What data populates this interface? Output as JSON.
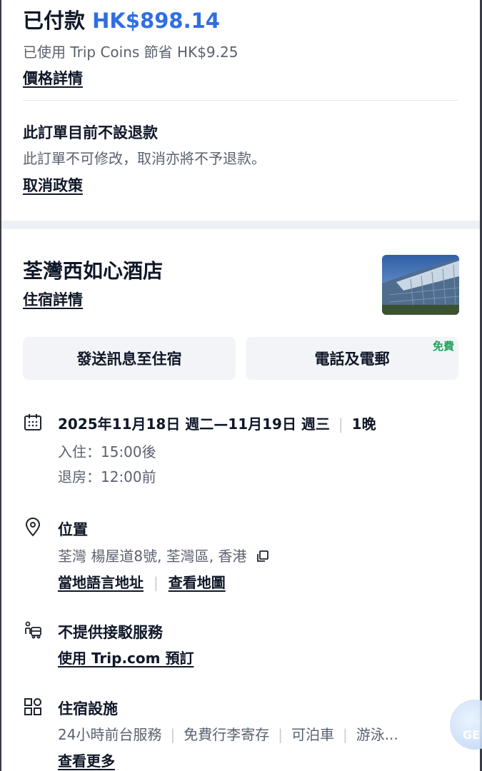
{
  "payment": {
    "paid_label": "已付款",
    "paid_amount": "HK$898.14",
    "coins_text": "已使用 Trip Coins 節省 HK$9.25",
    "price_details_link": "價格詳情"
  },
  "refund": {
    "title": "此訂單目前不設退款",
    "description": "此訂單不可修改，取消亦將不予退款。",
    "policy_link": "取消政策"
  },
  "hotel": {
    "name": "荃灣西如心酒店",
    "details_link": "住宿詳情"
  },
  "actions": {
    "message_label": "發送訊息至住宿",
    "call_label": "電話及電郵",
    "free_badge": "免費"
  },
  "stay": {
    "dates": "2025年11月18日 週二—11月19日 週三",
    "nights": "1晚",
    "checkin": "入住：15:00後",
    "checkout": "退房：12:00前"
  },
  "location": {
    "title": "位置",
    "address": "荃灣 楊屋道8號, 荃灣區, 香港",
    "local_address_link": "當地語言地址",
    "map_link": "查看地圖"
  },
  "transfer": {
    "title": "不提供接駁服務",
    "book_link": "使用 Trip.com 預訂"
  },
  "facilities": {
    "title": "住宿設施",
    "items": [
      "24小時前台服務",
      "免費行李寄存",
      "可泊車",
      "游泳..."
    ],
    "more_link": "查看更多"
  },
  "assistant": {
    "label": "GE"
  },
  "icons": {
    "calendar": "calendar-icon",
    "location": "location-pin-icon",
    "transfer": "shuttle-icon",
    "facilities": "grid-icon",
    "copy": "copy-icon"
  },
  "colors": {
    "accent": "#2f6fe0",
    "free": "#1fa35a",
    "text": "#0f1728",
    "muted": "#5b6170"
  }
}
